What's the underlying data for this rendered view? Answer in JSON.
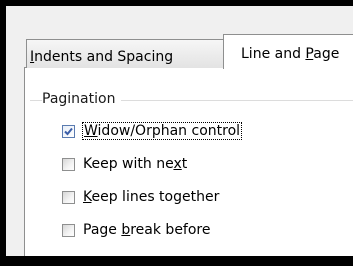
{
  "tabs": [
    {
      "pre": "",
      "accel": "I",
      "post": "ndents and Spacing",
      "selected": false
    },
    {
      "pre": "Line and ",
      "accel": "P",
      "post": "age",
      "selected": true
    }
  ],
  "pagination": {
    "group_label": "Pagination",
    "options": [
      {
        "pre": "",
        "accel": "W",
        "post": "idow/Orphan control",
        "checked": true,
        "focused": true
      },
      {
        "pre": "Keep with ne",
        "accel": "x",
        "post": "t",
        "checked": false,
        "focused": false
      },
      {
        "pre": "",
        "accel": "K",
        "post": "eep lines together",
        "checked": false,
        "focused": false
      },
      {
        "pre": "Page ",
        "accel": "b",
        "post": "reak before",
        "checked": false,
        "focused": false
      }
    ]
  },
  "colors": {
    "checkmark": "#3b5ea8"
  }
}
